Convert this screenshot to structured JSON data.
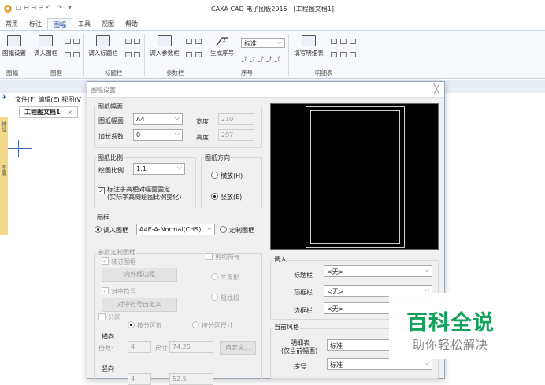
{
  "window": {
    "title": "CAXA CAD 电子图板2015 - [工程图文档1]",
    "quick_access": "□ ⊟ ⊟ ⊟ ↶ · ↷ · ▾"
  },
  "ribbon": {
    "tabs": [
      "常用",
      "标注",
      "图幅",
      "工具",
      "视图",
      "帮助"
    ],
    "active_tab": "图幅",
    "buttons": {
      "sheet_setup": "图幅设置",
      "load_frame": "调入图框",
      "load_titleblock": "调入标题栏",
      "load_params": "调入参数栏",
      "gen_seq": "生成序号",
      "fill_list": "填写明细表",
      "seq_style": "标准"
    },
    "groups": {
      "sheet": "图幅",
      "frame": "图框",
      "titleblock": "标题栏",
      "params": "参数栏",
      "seq": "序号",
      "list": "明细表"
    }
  },
  "cmdbar": {
    "menu": "文件(F)  编辑(E)  视图(V"
  },
  "doc": {
    "tab": "工程图文档1",
    "close": "×",
    "side1": "特性",
    "side2": "图层"
  },
  "dialog": {
    "title": "图幅设置",
    "close": "╳",
    "sheet_size": {
      "group": "图纸幅面",
      "size_label": "图纸幅面",
      "size_value": "A4",
      "ext_label": "加长系数",
      "ext_value": "0",
      "width_label": "宽度",
      "width_value": "210",
      "height_label": "高度",
      "height_value": "297"
    },
    "scale": {
      "group": "图纸比例",
      "label": "绘图比例",
      "value": "1:1",
      "fix_text_1": "标注字高相对幅面固定",
      "fix_text_2": "(实际字高随绘图比例变化)"
    },
    "orientation": {
      "group": "图纸方向",
      "landscape": "横放(H)",
      "portrait": "竖放(E)"
    },
    "frame": {
      "group": "图框",
      "load_frame": "调入图框",
      "frame_value": "A4E-A-Normal(CHS)",
      "custom_frame": "定制图框"
    },
    "param_custom": {
      "group": "参数定制图框",
      "binding": "装订图框",
      "inner_margin": "内外框边距",
      "center_mark": "对中符号",
      "center_custom": "对中符号自定义",
      "cut_mark": "剪切符号",
      "triangle": "三角形",
      "thick_line": "粗线段"
    },
    "zone": {
      "label": "分区",
      "by_count": "按分区数",
      "by_size": "按分区尺寸",
      "horizontal": "横向",
      "count_label": "份数:",
      "count_value": "4",
      "size_label": "尺寸",
      "size_value": "74.25",
      "custom_button": "自定义...",
      "vertical": "竖向",
      "v_count_value": "4",
      "v_size_value": "52.5"
    },
    "load": {
      "group": "调入",
      "titleblock": "标题栏",
      "titleblock_value": "<无>",
      "topbar": "顶框栏",
      "topbar_value": "<无>",
      "sidebar": "边框栏",
      "sidebar_value": "<无>"
    },
    "style": {
      "group": "当前风格",
      "list_label_1": "明细表",
      "list_label_2": "(仅当前幅面)",
      "list_value": "标准",
      "seq_label": "序号",
      "seq_value": "标准"
    }
  },
  "watermark": {
    "line1": "百科全说",
    "line2": "助你轻松解决"
  },
  "colors": {
    "accent": "#1a4b9b",
    "watermark_green": "#15a15a",
    "ruler_blue": "#3a6fc4"
  }
}
